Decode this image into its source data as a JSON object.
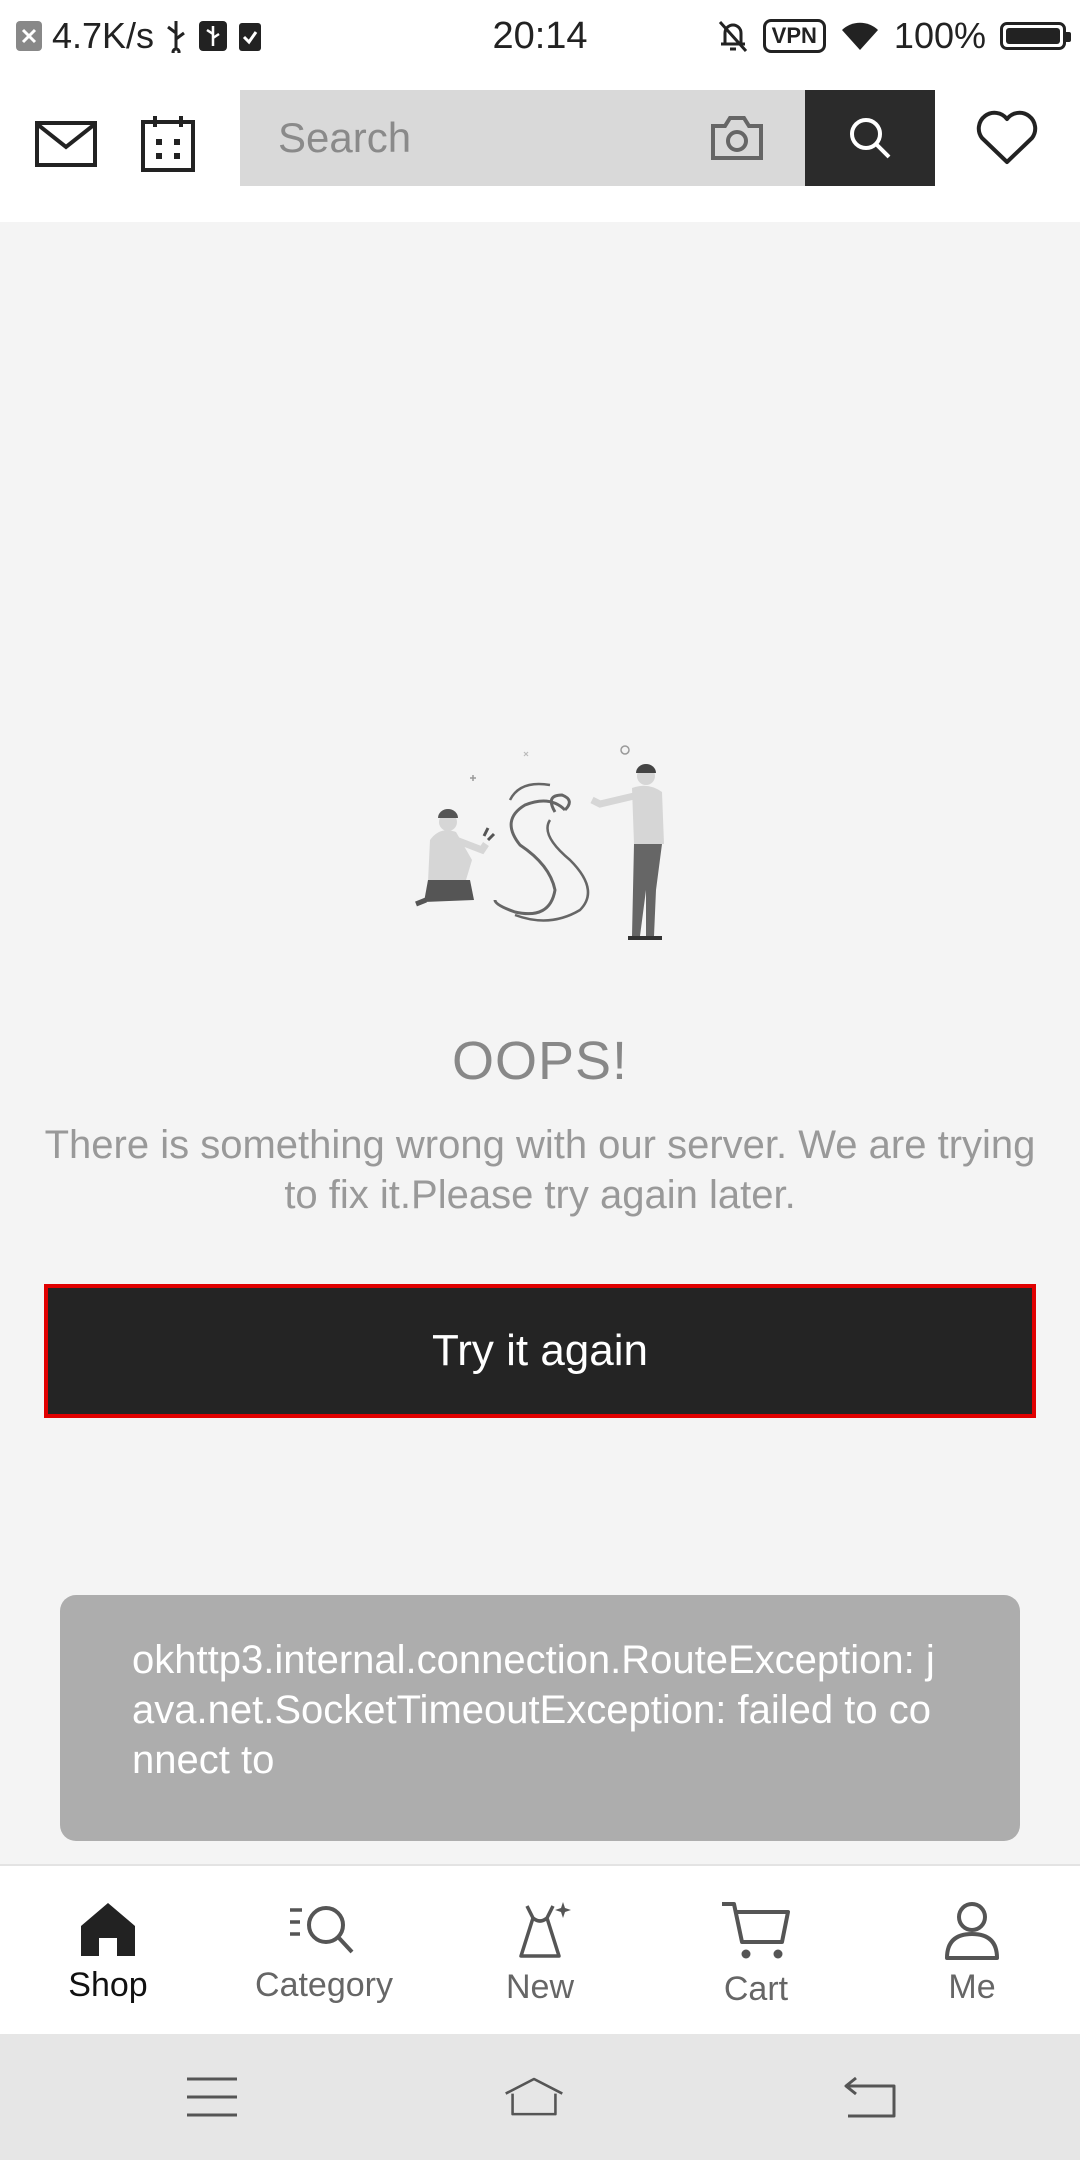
{
  "status_bar": {
    "net_speed": "4.7K/s",
    "time": "20:14",
    "vpn": "VPN",
    "battery": "100%"
  },
  "header": {
    "search_placeholder": "Search"
  },
  "error": {
    "title": "OOPS!",
    "message": "There is something wrong with our server. We are trying to fix it.Please try again later.",
    "retry_label": "Try it again"
  },
  "toast": {
    "text": "okhttp3.internal.connection.RouteException: java.net.SocketTimeoutException: failed to connect to"
  },
  "tabs": [
    {
      "label": "Shop",
      "icon": "home-icon",
      "active": true
    },
    {
      "label": "Category",
      "icon": "category-search-icon",
      "active": false
    },
    {
      "label": "New",
      "icon": "dress-icon",
      "active": false
    },
    {
      "label": "Cart",
      "icon": "cart-icon",
      "active": false
    },
    {
      "label": "Me",
      "icon": "person-icon",
      "active": false
    }
  ],
  "colors": {
    "accent": "#242424",
    "highlight_border": "#e00000",
    "background": "#f4f4f4"
  }
}
